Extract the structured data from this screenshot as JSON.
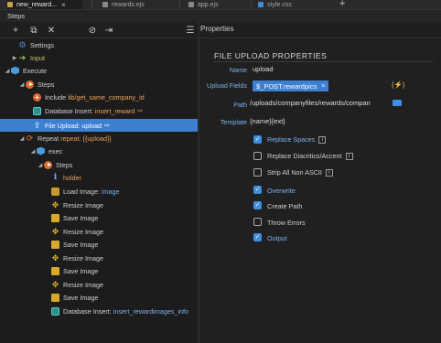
{
  "tabs": [
    {
      "label": "new_reward...",
      "active": true,
      "icon": "ejs-file-icon"
    },
    {
      "label": "rewards.ejs",
      "active": false,
      "icon": "ejs-file-icon"
    },
    {
      "label": "app.ejs",
      "active": false,
      "icon": "ejs-file-icon"
    },
    {
      "label": "style.css",
      "active": false,
      "icon": "css-file-icon"
    }
  ],
  "panel_title": "Steps",
  "properties_title": "Properties",
  "tree": [
    {
      "label": "Settings",
      "icon": "gear-icon"
    },
    {
      "label": "Input",
      "icon": "input-arrow-icon"
    },
    {
      "label": "Execute",
      "icon": "cube-icon"
    },
    {
      "label": "Steps",
      "icon": "play-icon"
    },
    {
      "label": "Include",
      "value": "lib/get_same_company_id",
      "icon": "include-plus-icon"
    },
    {
      "label": "Database Insert:",
      "value": "insert_reward",
      "icon": "database-table-icon"
    },
    {
      "label": "File Upload:",
      "value": "upload",
      "icon": "upload-icon",
      "selected": true
    },
    {
      "label": "Repeat",
      "value": "repeat: {{upload}}",
      "icon": "repeat-icon"
    },
    {
      "label": "exec",
      "icon": "cube-icon"
    },
    {
      "label": "Steps",
      "icon": "play-icon"
    },
    {
      "label": "holder",
      "icon": "info-icon"
    },
    {
      "label": "Load Image:",
      "value": "image",
      "icon": "image-icon"
    },
    {
      "label": "Resize Image",
      "icon": "resize-icon"
    },
    {
      "label": "Save Image",
      "icon": "save-icon"
    },
    {
      "label": "Resize Image",
      "icon": "resize-icon"
    },
    {
      "label": "Save Image",
      "icon": "save-icon"
    },
    {
      "label": "Resize Image",
      "icon": "resize-icon"
    },
    {
      "label": "Save Image",
      "icon": "save-icon"
    },
    {
      "label": "Resize Image",
      "icon": "resize-icon"
    },
    {
      "label": "Save Image",
      "icon": "save-icon"
    },
    {
      "label": "Database Insert:",
      "value": "insert_rewardimages_info",
      "icon": "database-table-icon"
    }
  ],
  "props": {
    "section_title": "FILE UPLOAD PROPERTIES",
    "name_label": "Name",
    "name_value": "upload",
    "upload_fields_label": "Upload Fields",
    "upload_fields_chip": "$_POST.rewardpics",
    "path_label": "Path",
    "path_value": "/uploads/companyfiles/rewards/compan",
    "template_label": "Template",
    "template_value": "{name}{ext}",
    "options": [
      {
        "label": "Replace Spaces",
        "checked": true,
        "info": true
      },
      {
        "label": "Replace Diacritics/Accent",
        "checked": false,
        "info": true
      },
      {
        "label": "Strip All Non ASCII",
        "checked": false,
        "info": true
      },
      {
        "label": "Overwrite",
        "checked": true,
        "info": false
      },
      {
        "label": "Create Path",
        "checked": true,
        "info": false
      },
      {
        "label": "Throw Errors",
        "checked": false,
        "info": false
      },
      {
        "label": "Output",
        "checked": true,
        "info": false
      }
    ]
  }
}
